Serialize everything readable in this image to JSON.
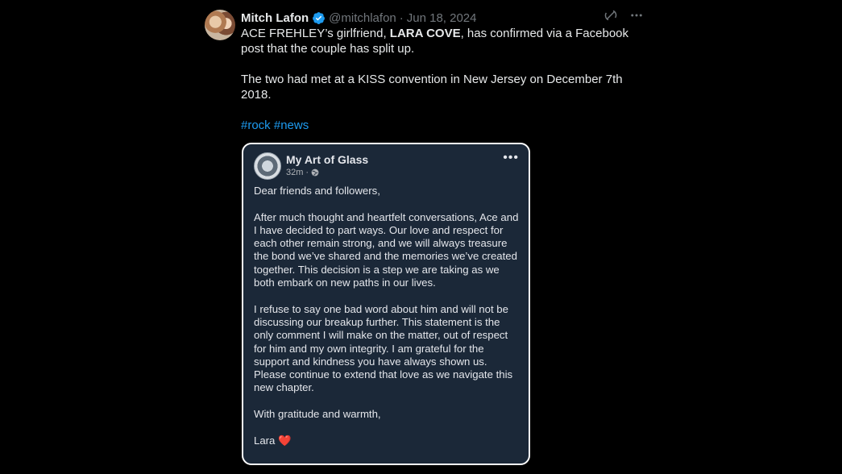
{
  "tweet": {
    "author_name": "Mitch Lafon",
    "handle": "@mitchlafon",
    "separator": "·",
    "date": "Jun 18, 2024",
    "more_label": "···",
    "text_part1": "ACE FREHLEY’s girlfriend, ",
    "text_bold": "LARA COVE",
    "text_part2": ", has confirmed via a Facebook post that the couple has split up.",
    "paragraph2": "The two had met at a KISS convention in New Jersey on December 7th 2018.",
    "hashtags": [
      "#rock",
      "#news"
    ],
    "colors": {
      "link": "#1d9bf0",
      "verified": "#1d9bf0",
      "muted": "#71767b"
    }
  },
  "embedded_post": {
    "page_name": "My Art of Glass",
    "time": "32m",
    "meta_separator": "·",
    "audience_icon": "globe-icon",
    "more_label": "•••",
    "paragraphs": [
      "Dear friends and followers,",
      "After much thought and heartfelt conversations, Ace and I have decided to part ways. Our love and respect for each other remain strong, and we will always treasure the bond we’ve shared and the memories we’ve created together. This decision is a step we are taking as we both embark on new paths in our lives.",
      "I refuse to say one bad word about him and will not be discussing our breakup further. This statement is the only comment I will make on the matter, out of respect for him and my own integrity. I am grateful for the support and kindness you have always shown us. Please continue to extend that love as we navigate this new chapter.",
      "With gratitude and warmth,"
    ],
    "signature": "Lara",
    "signature_emoji": "❤️"
  }
}
